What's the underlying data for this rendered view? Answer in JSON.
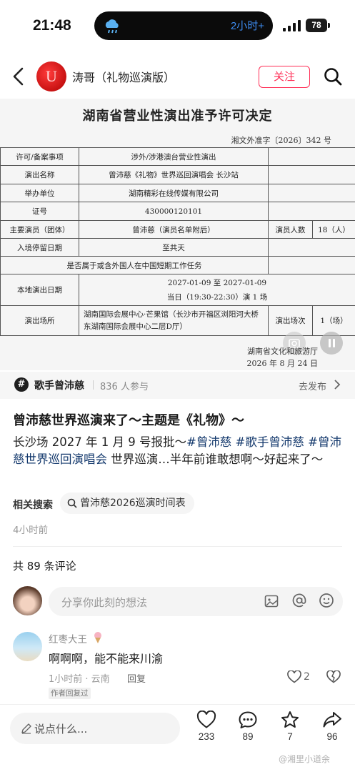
{
  "status_bar": {
    "time": "21:48",
    "island_text": "2小时+",
    "battery": "78"
  },
  "nav": {
    "author_name": "涛哥（礼物巡演版）",
    "follow_label": "关注"
  },
  "document": {
    "title": "湖南省营业性演出准予许可决定",
    "ref_no": "湘文外准字〔2026〕342 号",
    "rows": {
      "permit_type_label": "许可/备案事项",
      "permit_type": "涉外/涉港澳台营业性演出",
      "show_name_label": "演出名称",
      "show_name": "曾沛慈《礼物》世界巡回演唱会 长沙站",
      "organizer_label": "举办单位",
      "organizer": "湖南精彩在线传媒有限公司",
      "cert_label": "证号",
      "cert_no": "430000120101",
      "performer_label": "主要演员（团体）",
      "performer": "曾沛慈（演员名单附后）",
      "count_label": "演员人数",
      "count": "18（人）",
      "stay_label": "入境停留日期",
      "stay": "至共天",
      "foreign_work_label": "是否属于或含外国人在中国短期工作任务",
      "date_label": "本地演出日期",
      "date_range": "2027-01-09 至 2027-01-09",
      "date_detail": "当日（19:30-22:30）演 1 场",
      "venue_label": "演出场所",
      "venue": "湖南国际会展中心·芒果馆（长沙市开福区浏阳河大桥东湖南国际会展中心二层D厅）",
      "sessions_label": "演出场次",
      "sessions": "1（场）"
    },
    "issuer": "湖南省文化和旅游厅",
    "issue_date": "2026 年 8 月 24 日"
  },
  "topic": {
    "name": "歌手曾沛慈",
    "participants": "836 人参与",
    "publish": "去发布"
  },
  "post": {
    "title": "曾沛慈世界巡演来了～主题是《礼物》～",
    "body_prefix": "长沙场 2027 年 1 月 9 号报批～",
    "tag1": "#曾沛慈",
    "tag2": "#歌手曾沛慈",
    "tag3": "#曾沛慈世界巡回演唱会",
    "body_suffix": " 世界巡演…半年前谁敢想啊～好起来了～",
    "related_label": "相关搜索",
    "related_chip": "曾沛慈2026巡演时间表",
    "time": "4小时前"
  },
  "comments": {
    "count": "共 89 条评论",
    "input_placeholder": "分享你此刻的想法",
    "items": [
      {
        "name": "红枣大王",
        "text": "啊啊啊，能不能来川渝",
        "meta": "1小时前 · 云南",
        "reply": "回复",
        "likes": "2",
        "badge": "作者回复过"
      }
    ]
  },
  "bottom": {
    "say_placeholder": "说点什么...",
    "likes": "233",
    "comments": "89",
    "stars": "7",
    "shares": "96"
  },
  "watermark": "@湘里小道余",
  "colors": {
    "accent": "#ff2d55",
    "tag": "#13386c"
  }
}
